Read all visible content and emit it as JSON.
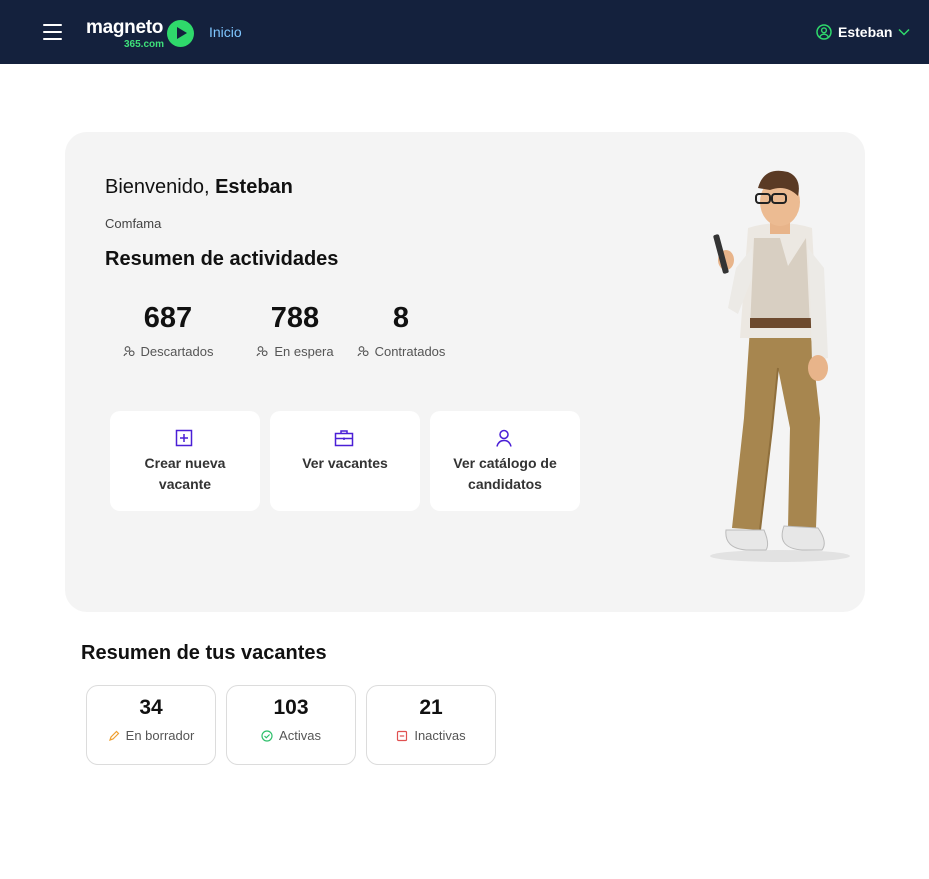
{
  "header": {
    "menu_icon": "hamburger-icon",
    "logo_word": "magneto",
    "logo_sub": "365.com",
    "nav_home": "Inicio",
    "user_name": "Esteban",
    "user_icon": "user-circle-icon",
    "colors": {
      "bar": "#14213d",
      "accent": "#2fd96b",
      "link": "#7fc6ff"
    }
  },
  "hero": {
    "welcome_prefix": "Bienvenido,",
    "welcome_name": "Esteban",
    "company": "Comfama",
    "activities_title": "Resumen de actividades",
    "stats": [
      {
        "value": "687",
        "label": "Descartados",
        "icon": "people-icon"
      },
      {
        "value": "788",
        "label": "En espera",
        "icon": "people-icon"
      },
      {
        "value": "8",
        "label": "Contratados",
        "icon": "people-icon"
      }
    ],
    "actions": [
      {
        "label": "Crear nueva vacante",
        "icon": "plus-square-icon"
      },
      {
        "label": "Ver vacantes",
        "icon": "briefcase-icon"
      },
      {
        "label": "Ver catálogo de candidatos",
        "icon": "person-icon"
      }
    ],
    "action_icon_color": "#4a1fd6"
  },
  "vacancies": {
    "title": "Resumen de tus vacantes",
    "cards": [
      {
        "value": "34",
        "label": "En borrador",
        "icon": "pencil-icon",
        "color": "#f0a030"
      },
      {
        "value": "103",
        "label": "Activas",
        "icon": "check-circle-icon",
        "color": "#2fbf6b"
      },
      {
        "value": "21",
        "label": "Inactivas",
        "icon": "minus-square-icon",
        "color": "#e05050"
      }
    ]
  }
}
